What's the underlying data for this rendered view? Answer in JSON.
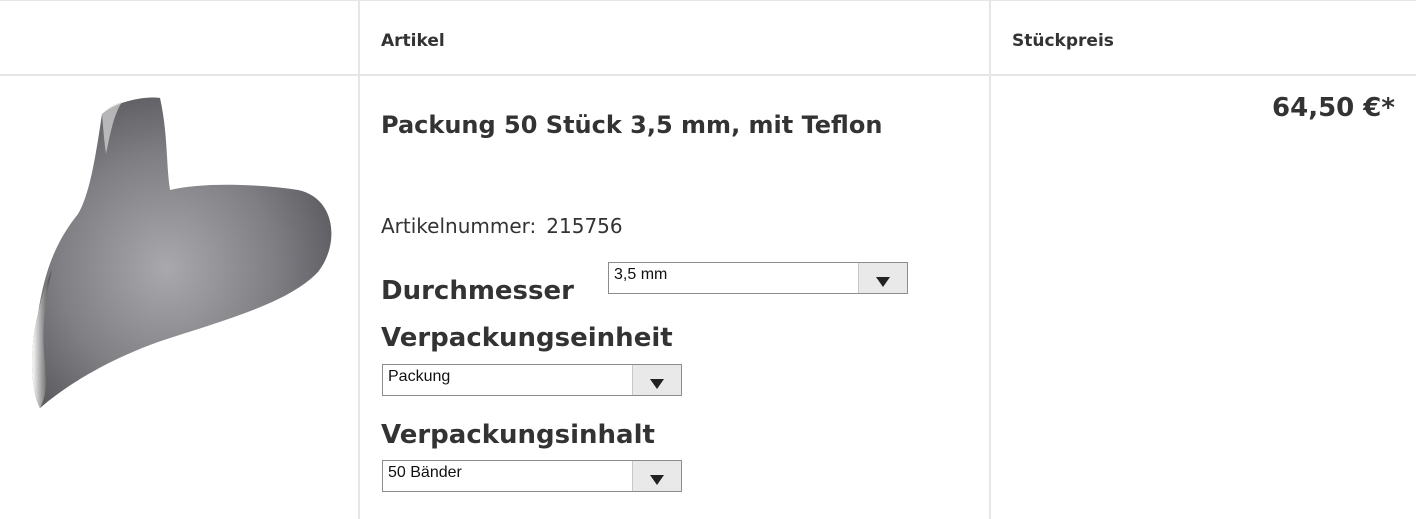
{
  "table": {
    "headers": {
      "article": "Artikel",
      "unit_price": "Stückpreis"
    }
  },
  "product": {
    "image_icon": "orthodontic-matrix-band-image",
    "title": "Packung 50 Stück 3,5 mm, mit Teflon",
    "article_number_label": "Artikelnummer:",
    "article_number": "215756",
    "price": "64,50 €*",
    "options": {
      "diameter": {
        "label": "Durchmesser",
        "selected": "3,5 mm"
      },
      "packaging_unit": {
        "label": "Verpackungseinheit",
        "selected": "Packung"
      },
      "packaging_content": {
        "label": "Verpackungsinhalt",
        "selected": "50 Bänder"
      }
    }
  },
  "colors": {
    "text": "#333333",
    "border": "#e6e6e6",
    "select_button": "#e9e9e9"
  }
}
